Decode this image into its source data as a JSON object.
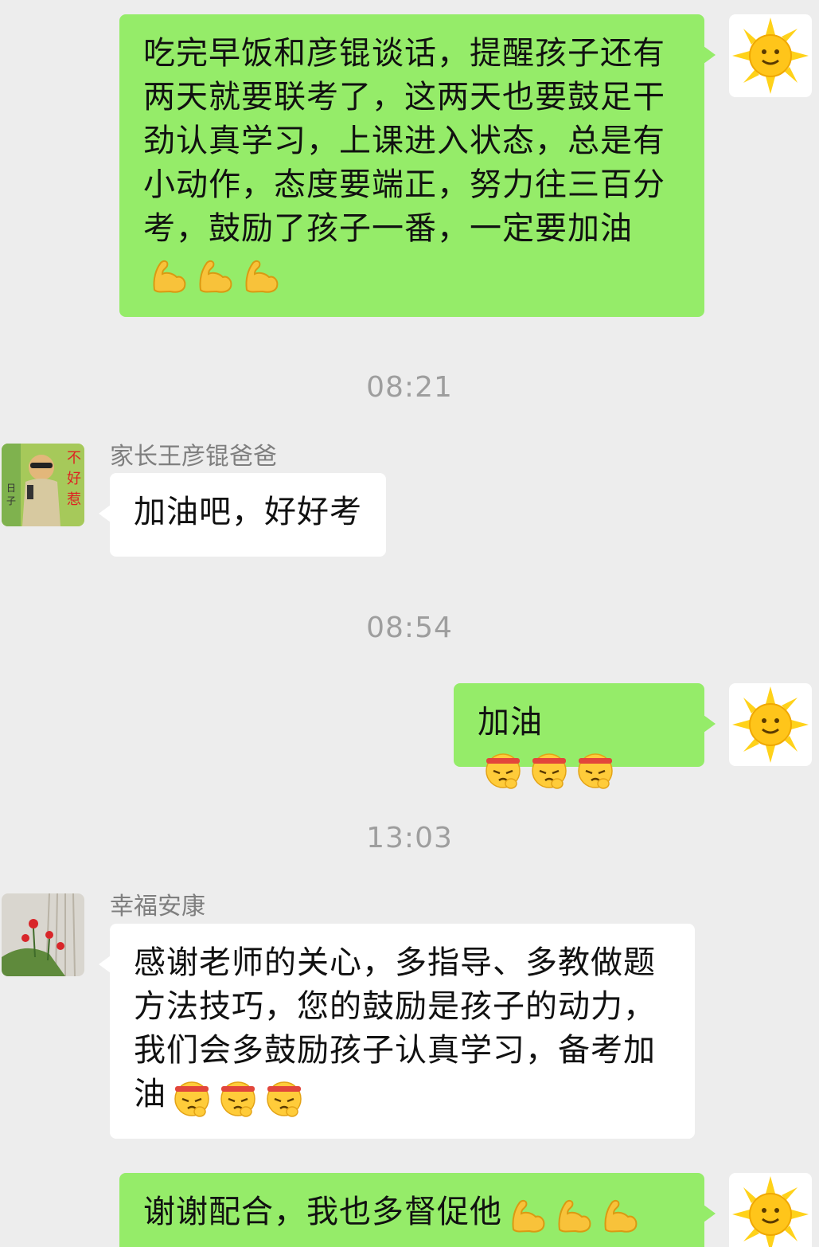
{
  "messages": [
    {
      "type": "outgoing",
      "text": "吃完早饭和彦锟谈话，提醒孩子还有两天就要联考了，这两天也要鼓足干劲认真学习，上课进入状态，总是有小动作，态度要端正，努力往三百分考，鼓励了孩子一番，一定要加油",
      "emojis": [
        "flexed-biceps",
        "flexed-biceps",
        "flexed-biceps"
      ]
    },
    {
      "type": "timestamp",
      "text": "08:21"
    },
    {
      "type": "incoming",
      "sender": "家长王彦锟爸爸",
      "text": "加油吧，好好考",
      "avatar": "child-photo-avatar",
      "avatar_caption": [
        "不",
        "好",
        "惹"
      ],
      "avatar_side": [
        "日",
        "子"
      ]
    },
    {
      "type": "timestamp",
      "text": "08:54"
    },
    {
      "type": "outgoing",
      "text": "加油",
      "emojis": [
        "determined-face",
        "determined-face",
        "determined-face"
      ]
    },
    {
      "type": "timestamp",
      "text": "13:03"
    },
    {
      "type": "incoming",
      "sender": "幸福安康",
      "text": "感谢老师的关心，多指导、多教做题方法技巧，您的鼓励是孩子的动力，我们会多鼓励孩子认真学习，备考加油",
      "emojis": [
        "determined-face",
        "determined-face",
        "determined-face"
      ],
      "avatar": "flowers-photo-avatar"
    },
    {
      "type": "outgoing",
      "text": "谢谢配合，我也多督促他",
      "emojis": [
        "flexed-biceps",
        "flexed-biceps",
        "flexed-biceps"
      ]
    }
  ],
  "colors": {
    "outgoing_bubble": "#95ec69",
    "incoming_bubble": "#ffffff",
    "background": "#ededed",
    "timestamp": "#9e9e9e"
  }
}
